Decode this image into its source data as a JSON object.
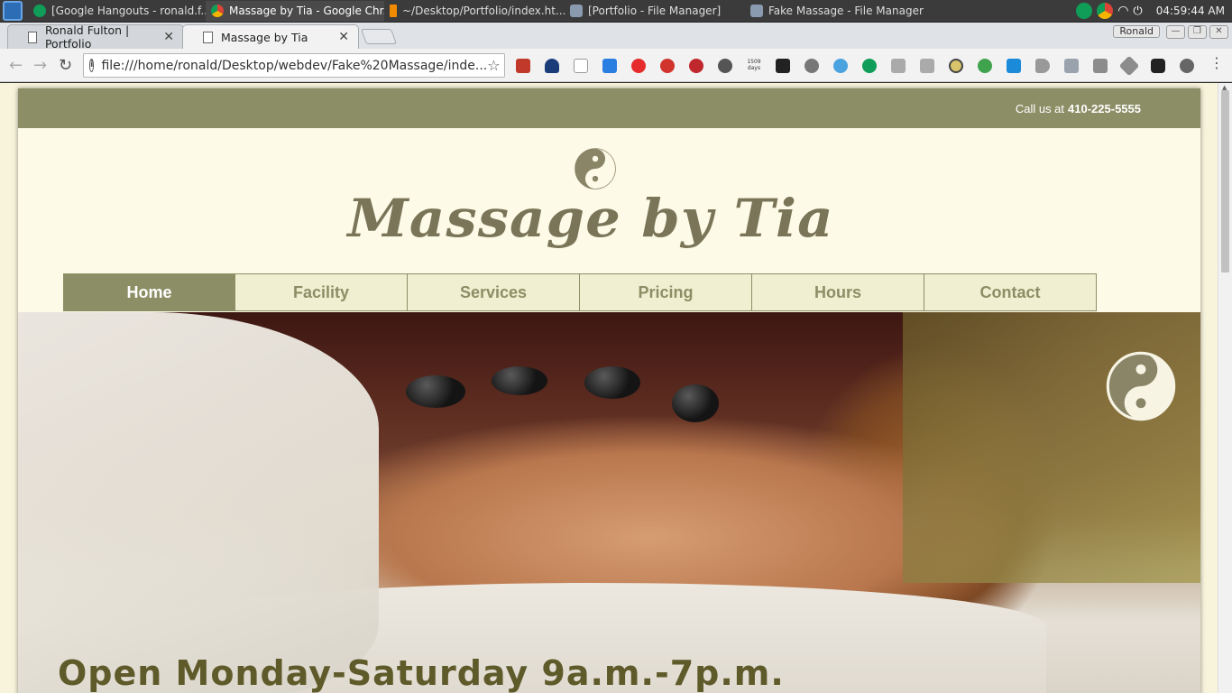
{
  "taskbar": {
    "tasks": [
      {
        "label": "[Google Hangouts - ronald.f...",
        "active": false
      },
      {
        "label": "Massage by Tia - Google Chr...",
        "active": true
      },
      {
        "label": "~/Desktop/Portfolio/index.ht...",
        "active": false
      },
      {
        "label": "[Portfolio - File Manager]",
        "active": false
      },
      {
        "label": "Fake Massage - File Manager",
        "active": false
      }
    ],
    "clock": "04:59:44 AM"
  },
  "browser": {
    "tabs": [
      {
        "title": "Ronald Fulton | Portfolio",
        "active": false
      },
      {
        "title": "Massage by Tia",
        "active": true
      }
    ],
    "profile": "Ronald",
    "url": "file:///home/ronald/Desktop/webdev/Fake%20Massage/inde...",
    "extensions": [
      "book-icon",
      "cloud-icon",
      "mail-icon",
      "download-icon",
      "opera-icon",
      "timer-icon",
      "adblock-icon",
      "steering-icon",
      "counter-icon",
      "mask-icon",
      "clip-icon",
      "pulse-icon",
      "hangouts-icon",
      "t-icon",
      "r-icon",
      "bulb-icon",
      "id-icon",
      "s-icon",
      "play-icon",
      "arrow-icon",
      "camera-icon",
      "layers-icon",
      "hex-icon",
      "gear-icon",
      "menu-icon"
    ],
    "extension_counter_label": "1509 days"
  },
  "site": {
    "call_prefix": "Call us at",
    "phone": "410-225-5555",
    "title": "Massage by Tia",
    "nav": [
      "Home",
      "Facility",
      "Services",
      "Pricing",
      "Hours",
      "Contact"
    ],
    "active_nav": "Home",
    "hero_text": "Open Monday-Saturday 9a.m.-7p.m.",
    "colors": {
      "olive": "#8c8e65",
      "cream": "#fdfbe8",
      "nav_bg": "#f0efd1",
      "title_text": "#7a7558"
    }
  }
}
